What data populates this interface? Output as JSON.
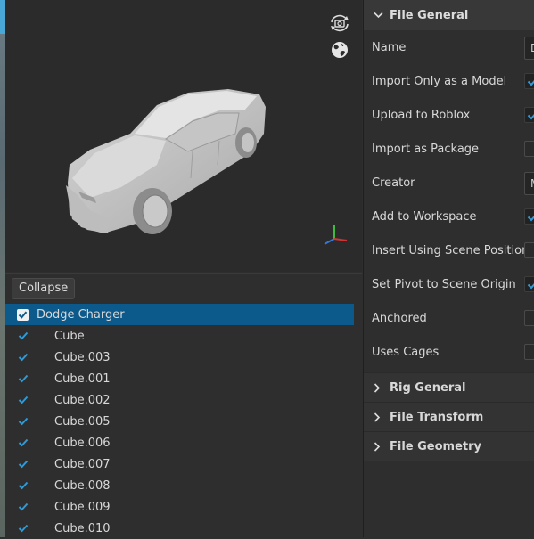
{
  "preview": {
    "camera_reset_icon": "camera-rotate-icon",
    "globe_icon": "globe-icon"
  },
  "tree": {
    "collapse_label": "Collapse",
    "root": {
      "label": "Dodge Charger",
      "checked": true
    },
    "children": [
      {
        "label": "Cube",
        "checked": true
      },
      {
        "label": "Cube.003",
        "checked": true
      },
      {
        "label": "Cube.001",
        "checked": true
      },
      {
        "label": "Cube.002",
        "checked": true
      },
      {
        "label": "Cube.005",
        "checked": true
      },
      {
        "label": "Cube.006",
        "checked": true
      },
      {
        "label": "Cube.007",
        "checked": true
      },
      {
        "label": "Cube.008",
        "checked": true
      },
      {
        "label": "Cube.009",
        "checked": true
      },
      {
        "label": "Cube.010",
        "checked": true
      }
    ]
  },
  "properties": {
    "file_general": {
      "title": "File General",
      "rows": [
        {
          "label": "Name",
          "control": "input",
          "value": "D"
        },
        {
          "label": "Import Only as a Model",
          "control": "checkbox",
          "checked": true
        },
        {
          "label": "Upload to Roblox",
          "control": "checkbox",
          "checked": true
        },
        {
          "label": "Import as Package",
          "control": "checkbox",
          "checked": false
        },
        {
          "label": "Creator",
          "control": "input",
          "value": "M"
        },
        {
          "label": "Add to Workspace",
          "control": "checkbox",
          "checked": true
        },
        {
          "label": "Insert Using Scene Position",
          "control": "checkbox",
          "checked": false
        },
        {
          "label": "Set Pivot to Scene Origin",
          "control": "checkbox",
          "checked": true
        },
        {
          "label": "Anchored",
          "control": "checkbox",
          "checked": false
        },
        {
          "label": "Uses Cages",
          "control": "checkbox",
          "checked": false
        }
      ]
    },
    "collapsed_sections": [
      "Rig General",
      "File Transform",
      "File Geometry"
    ]
  },
  "colors": {
    "accent": "#2f9bd9",
    "selection": "#0c5a8c"
  }
}
